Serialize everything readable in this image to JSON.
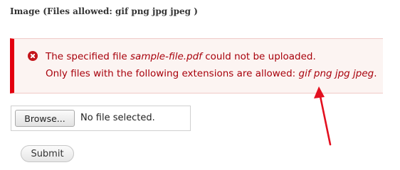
{
  "field": {
    "label": "Image (Files allowed: gif png jpg jpeg )"
  },
  "error": {
    "line1_prefix": "The specified file ",
    "line1_filename": "sample-file.pdf",
    "line1_suffix": " could not be uploaded.",
    "line2_prefix": "Only files with the following extensions are allowed: ",
    "line2_extensions": "gif png jpg jpeg",
    "line2_suffix": ".",
    "icon": "error-x-circle-icon"
  },
  "file_input": {
    "browse_label": "Browse...",
    "status_text": "No file selected."
  },
  "form": {
    "submit_label": "Submit"
  },
  "annotation": {
    "type": "red-arrow",
    "color": "#e3101f"
  }
}
